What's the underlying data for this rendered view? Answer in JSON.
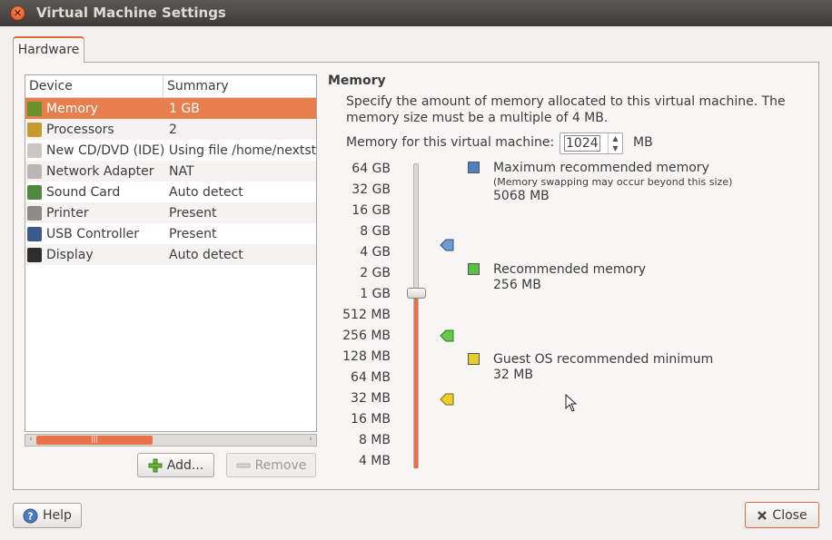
{
  "window": {
    "title": "Virtual Machine Settings",
    "close_glyph": "✕"
  },
  "tabs": [
    {
      "label": "Hardware"
    }
  ],
  "device_list": {
    "columns": {
      "device": "Device",
      "summary": "Summary"
    },
    "rows": [
      {
        "device": "Memory",
        "summary": "1 GB",
        "icon": "memory-icon",
        "color": "#6a8f2c"
      },
      {
        "device": "Processors",
        "summary": "2",
        "icon": "processor-icon",
        "color": "#c79a2e"
      },
      {
        "device": "New CD/DVD (IDE)",
        "summary": "Using file /home/nextst",
        "icon": "cd-icon",
        "color": "#c9c7c3"
      },
      {
        "device": "Network Adapter",
        "summary": "NAT",
        "icon": "network-icon",
        "color": "#b9b7b3"
      },
      {
        "device": "Sound Card",
        "summary": "Auto detect",
        "icon": "sound-card-icon",
        "color": "#4f8a3c"
      },
      {
        "device": "Printer",
        "summary": "Present",
        "icon": "printer-icon",
        "color": "#8d8b87"
      },
      {
        "device": "USB Controller",
        "summary": "Present",
        "icon": "usb-icon",
        "color": "#3a5a8c"
      },
      {
        "device": "Display",
        "summary": "Auto detect",
        "icon": "display-icon",
        "color": "#2d2d2d"
      }
    ],
    "scrollbar": {
      "left_arrow": "‹",
      "right_arrow": "›",
      "thumb_grip": "|||"
    }
  },
  "buttons": {
    "add": {
      "label": "Add...",
      "icon": "plus-icon"
    },
    "remove": {
      "label": "Remove",
      "icon": "minus-icon"
    },
    "help": {
      "label": "Help",
      "icon": "help-icon"
    },
    "close": {
      "label": "Close",
      "icon": "close-icon"
    }
  },
  "memory": {
    "title": "Memory",
    "description": "Specify the amount of memory allocated to this virtual machine. The memory size must be a multiple of 4 MB.",
    "field_label": "Memory for this virtual machine:",
    "value": "1024",
    "unit": "MB",
    "spin_up": "▲",
    "spin_down": "▼",
    "ticks": [
      "64 GB",
      "32 GB",
      "16 GB",
      "8 GB",
      "4 GB",
      "2 GB",
      "1 GB",
      "512 MB",
      "256 MB",
      "128 MB",
      "64 MB",
      "32 MB",
      "16 MB",
      "8 MB",
      "4 MB"
    ],
    "slider_value": "1 GB",
    "legend": {
      "maximum": {
        "title": "Maximum recommended memory",
        "note": "(Memory swapping may occur beyond this size)",
        "value": "5068 MB",
        "color": "#4f7fbf"
      },
      "recommended": {
        "title": "Recommended memory",
        "value": "256 MB",
        "color": "#5cc044"
      },
      "minimum": {
        "title": "Guest OS recommended minimum",
        "value": "32 MB",
        "color": "#e6cf2a"
      }
    }
  }
}
